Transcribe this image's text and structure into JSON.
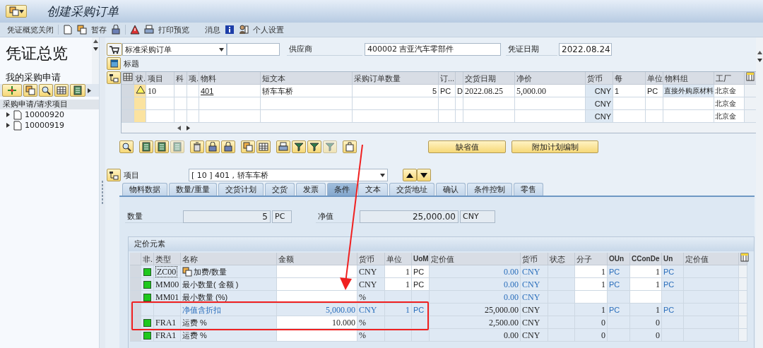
{
  "window": {
    "title": "创建采购订单"
  },
  "toolbar": [
    {
      "label": "凭证概览关闭"
    },
    {
      "label": "暂存"
    },
    {
      "label": "打印预览"
    },
    {
      "label": "消息"
    },
    {
      "label": "个人设置"
    }
  ],
  "left_panel": {
    "title": "凭证总览",
    "subtitle": "我的采购申请",
    "tree_header": "采购申请/请求项目",
    "tree": [
      {
        "label": "10000920",
        "expanded": false
      },
      {
        "label": "10000919",
        "expanded": false
      }
    ]
  },
  "header": {
    "order_type": "标准采购订单",
    "vendor_label": "供应商",
    "vendor": "400002 吉亚汽车零部件",
    "date_label": "凭证日期",
    "date": "2022.08.24",
    "section_label": "标题"
  },
  "items_table": {
    "columns": [
      "状.",
      "项目",
      "科",
      "项.",
      "物料",
      "短文本",
      "采购订单数量",
      "订...",
      null,
      "交货日期",
      "净价",
      "货币",
      "每",
      "单位",
      "物料组",
      "工厂"
    ],
    "rows": [
      {
        "warning": true,
        "cells": [
          null,
          "10",
          null,
          null,
          "401",
          "轿车车桥",
          "5",
          "PC",
          "D",
          "2022.08.25",
          "5,000.00",
          "CNY",
          "1",
          "PC",
          "直接外购原材料",
          "北京金"
        ]
      },
      {
        "warning": false,
        "cells": [
          null,
          null,
          null,
          null,
          null,
          null,
          null,
          null,
          null,
          null,
          null,
          "CNY",
          null,
          null,
          null,
          "北京金"
        ]
      },
      {
        "warning": false,
        "cells": [
          null,
          null,
          null,
          null,
          null,
          null,
          null,
          null,
          null,
          null,
          null,
          "CNY",
          null,
          null,
          null,
          "北京金"
        ]
      }
    ]
  },
  "buttons": [
    "缺省值",
    "附加计划编制"
  ],
  "item_selector": {
    "label": "项目",
    "value": "[ 10 ] 401 , 轿车车桥"
  },
  "tabs": [
    {
      "label": "物料数据",
      "selected": false
    },
    {
      "label": "数量/重量",
      "selected": false
    },
    {
      "label": "交货计划",
      "selected": false
    },
    {
      "label": "交货",
      "selected": false
    },
    {
      "label": "发票",
      "selected": false
    },
    {
      "label": "条件",
      "selected": true
    },
    {
      "label": "文本",
      "selected": false
    },
    {
      "label": "交货地址",
      "selected": false
    },
    {
      "label": "确认",
      "selected": false
    },
    {
      "label": "条件控制",
      "selected": false
    },
    {
      "label": "零售",
      "selected": false
    }
  ],
  "summary": {
    "quantity_label": "数量",
    "quantity": "5",
    "quantity_unit": "PC",
    "net_label": "净值",
    "net_value": "25,000.00",
    "net_currency": "CNY"
  },
  "pricing": {
    "title": "定价元素",
    "columns": [
      "非.",
      "类型",
      "名称",
      "金额",
      "货币",
      "单位",
      "UoM",
      "定价值",
      "货币",
      "状态",
      "分子",
      "OUn",
      "CConDe",
      "Un",
      "定价值"
    ],
    "rows": [
      {
        "kind": "condition",
        "active": true,
        "focused": true,
        "statistical": true,
        "unit_editable": true,
        "conversion_editable": true,
        "cells": [
          null,
          "ZC00",
          "加费/数量",
          null,
          "CNY",
          "1",
          "PC",
          "0.00",
          "CNY",
          null,
          "1",
          "PC",
          "1",
          "PC",
          null
        ]
      },
      {
        "kind": "condition",
        "active": true,
        "focused": false,
        "statistical": true,
        "unit_editable": true,
        "conversion_editable": true,
        "cells": [
          null,
          "MM00",
          "最小数量( 金额 )",
          null,
          "CNY",
          "1",
          "PC",
          "0.00",
          "CNY",
          null,
          "1",
          "PC",
          "1",
          "PC",
          null
        ]
      },
      {
        "kind": "condition",
        "active": true,
        "focused": false,
        "statistical": true,
        "unit_editable": false,
        "conversion_editable": true,
        "cells": [
          null,
          "MM01",
          "最小数量 (%)",
          null,
          "%",
          null,
          null,
          "0.00",
          "CNY",
          null,
          null,
          null,
          null,
          null,
          null
        ]
      },
      {
        "kind": "subtotal",
        "active": false,
        "focused": false,
        "statistical": false,
        "unit_editable": false,
        "conversion_editable": false,
        "cells": [
          null,
          null,
          "净值含折扣",
          "5,000.00",
          "CNY",
          "1",
          "PC",
          "25,000.00",
          "CNY",
          null,
          "1",
          "PC",
          "1",
          "PC",
          null
        ]
      },
      {
        "kind": "condition",
        "active": true,
        "focused": false,
        "statistical": false,
        "unit_editable": false,
        "conversion_editable": false,
        "cells": [
          null,
          "FRA1",
          "运费 %",
          "10.000",
          "%",
          null,
          null,
          "2,500.00",
          "CNY",
          null,
          "0",
          null,
          "0",
          null,
          null
        ]
      },
      {
        "kind": "condition",
        "active": true,
        "focused": false,
        "statistical": false,
        "unit_editable": false,
        "conversion_editable": false,
        "cells": [
          null,
          "FRA1",
          "运费 %",
          null,
          "%",
          null,
          null,
          "0.00",
          "CNY",
          null,
          "0",
          null,
          "0",
          null,
          null
        ]
      }
    ]
  }
}
